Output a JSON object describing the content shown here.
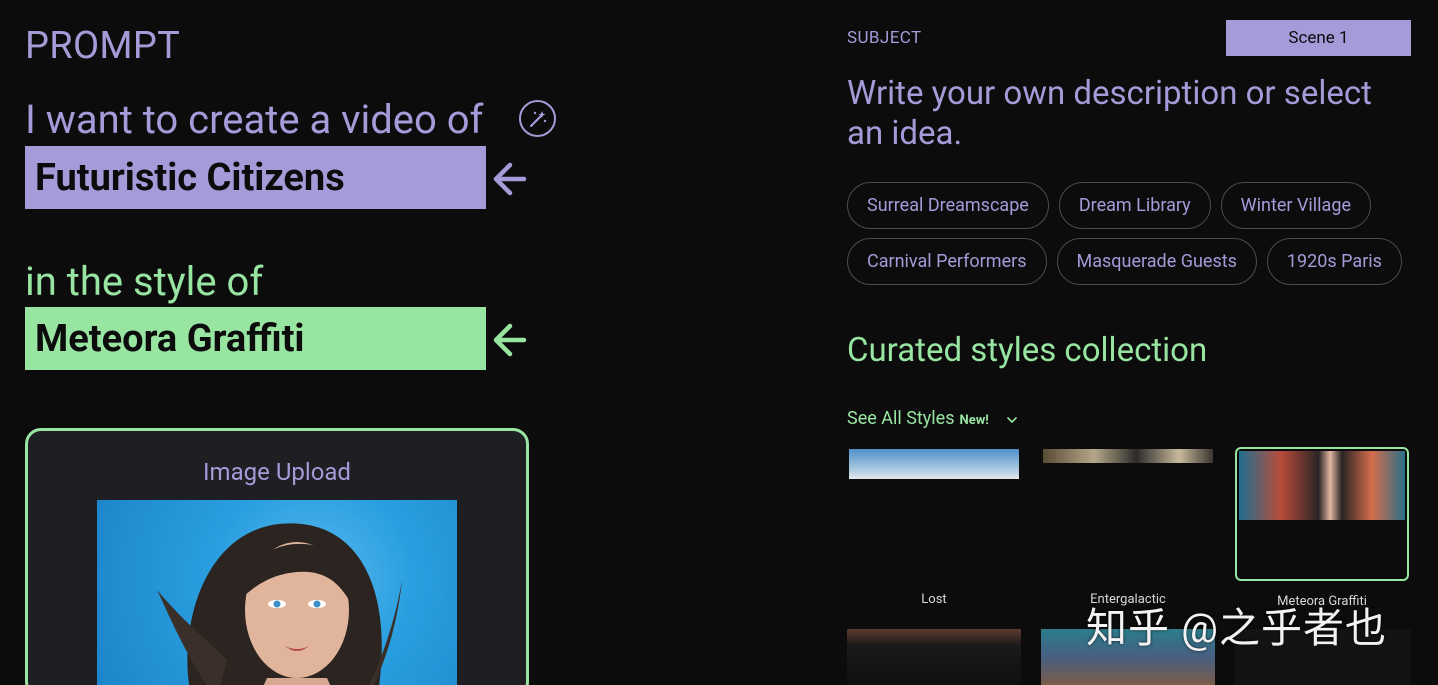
{
  "left_panel": {
    "heading": "PROMPT",
    "lead_text": "I want to create a video of",
    "subject_value": "Futuristic Citizens",
    "style_lead_text": "in the style of",
    "style_value": "Meteora Graffiti",
    "upload": {
      "title": "Image Upload"
    }
  },
  "right_panel": {
    "subject_label": "SUBJECT",
    "scene_button": "Scene 1",
    "description": "Write your own description or select an idea.",
    "ideas": [
      "Surreal Dreamscape",
      "Dream Library",
      "Winter Village",
      "Carnival Performers",
      "Masquerade Guests",
      "1920s Paris"
    ],
    "curated_title": "Curated styles collection",
    "see_all": {
      "label": "See All Styles",
      "badge": "New!"
    },
    "styles": [
      {
        "name": "Lost",
        "selected": false
      },
      {
        "name": "Entergalactic",
        "selected": false
      },
      {
        "name": "Meteora Graffiti",
        "selected": true
      }
    ]
  },
  "watermark": "知乎 @之乎者也",
  "colors": {
    "background": "#0c0c0d",
    "lavender": "#a69ad9",
    "green": "#98e5a2",
    "card": "#1e1f23"
  },
  "icons": {
    "wand": "magic-wand-icon",
    "arrow": "arrow-left-icon",
    "chevron": "chevron-down-icon"
  }
}
